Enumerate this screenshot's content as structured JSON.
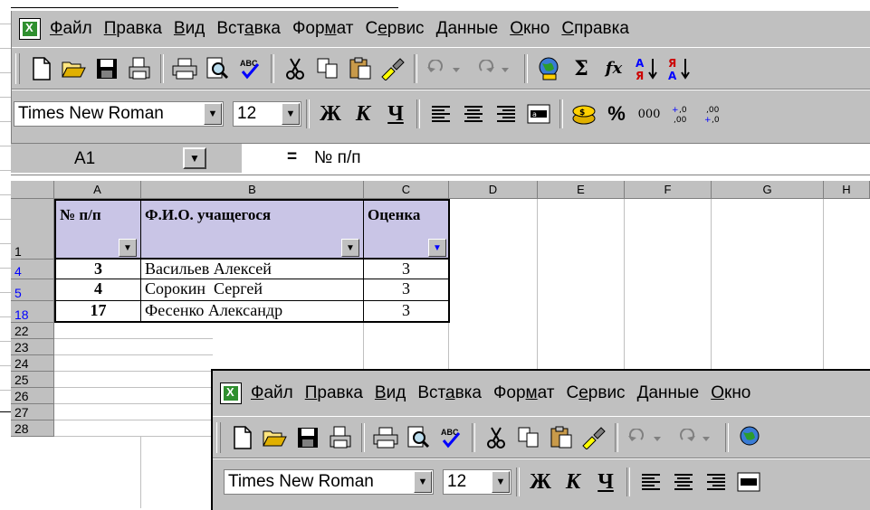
{
  "menu": [
    "Файл",
    "Правка",
    "Вид",
    "Вставка",
    "Формат",
    "Сервис",
    "Данные",
    "Окно",
    "Справка"
  ],
  "menu_underline": [
    "Ф",
    "П",
    "В",
    "а",
    "м",
    "е",
    "Д",
    "О",
    "С"
  ],
  "font_name": "Times New Roman",
  "font_size": "12",
  "format_buttons": {
    "bold": "Ж",
    "italic": "К",
    "underline": "Ч"
  },
  "number_buttons": {
    "percent": "%",
    "thousands": "000",
    "inc_decimal": ",0\n,00",
    "dec_decimal": ",00\n,0"
  },
  "formula": {
    "name_box": "A1",
    "equals": "=",
    "content": "№ п/п"
  },
  "columns": [
    "A",
    "B",
    "C",
    "D",
    "E",
    "F",
    "G",
    "H"
  ],
  "header_row_number": "1",
  "headers": [
    "№ п/п",
    "Ф.И.О. учащегося",
    "Оценка"
  ],
  "rows": [
    {
      "row": "4",
      "num": "3",
      "name": "Васильев Алексей",
      "grade": "3"
    },
    {
      "row": "5",
      "num": "4",
      "name": "Сорокин  Сергей",
      "grade": "3"
    },
    {
      "row": "18",
      "num": "17",
      "name": "Фесенко Александр",
      "grade": "3"
    }
  ],
  "empty_rows": [
    "22",
    "23",
    "24",
    "25",
    "26",
    "27",
    "28"
  ],
  "toolbar_icons": [
    "new-icon",
    "open-icon",
    "save-icon",
    "print-preview-icon",
    "print-icon",
    "preview-icon",
    "spelling-icon",
    "cut-icon",
    "copy-icon",
    "paste-icon",
    "format-painter-icon",
    "undo-icon",
    "redo-icon",
    "web-icon",
    "sum-icon",
    "function-icon",
    "sort-asc-icon",
    "sort-desc-icon"
  ],
  "symbols": {
    "sum": "Σ",
    "function": "fx"
  }
}
